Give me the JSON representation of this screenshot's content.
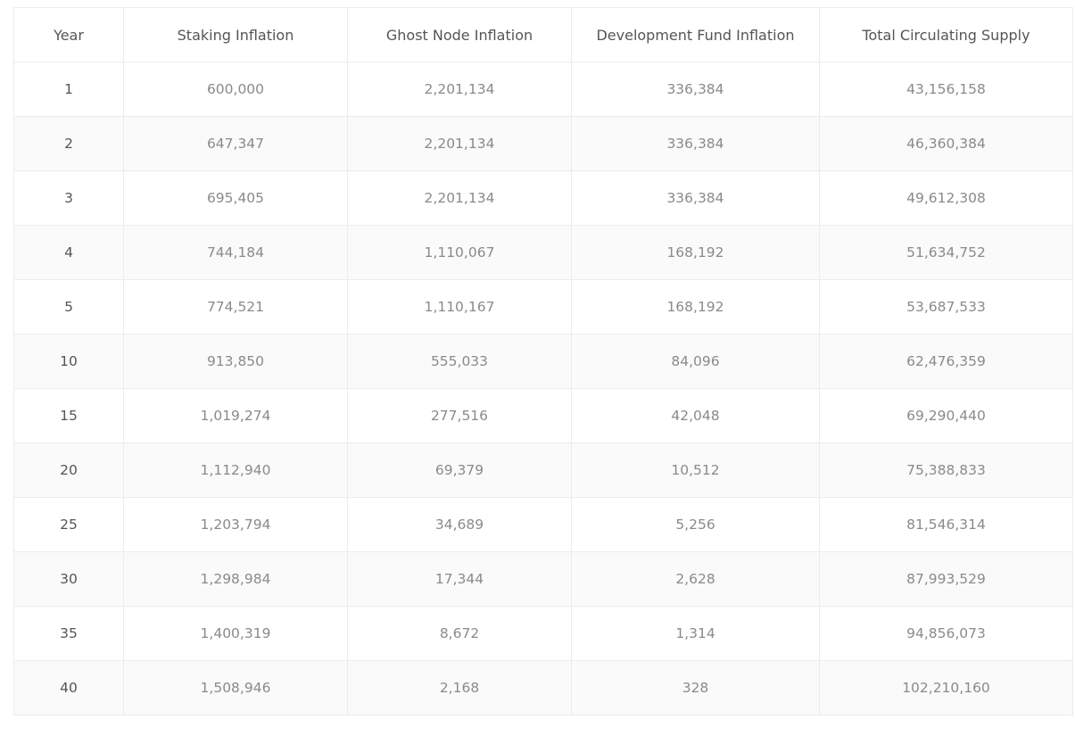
{
  "chart_data": {
    "type": "table",
    "columns": [
      "Year",
      "Staking Inflation",
      "Ghost Node Inflation",
      "Development Fund Inflation",
      "Total Circulating Supply"
    ],
    "rows": [
      [
        "1",
        "600,000",
        "2,201,134",
        "336,384",
        "43,156,158"
      ],
      [
        "2",
        "647,347",
        "2,201,134",
        "336,384",
        "46,360,384"
      ],
      [
        "3",
        "695,405",
        "2,201,134",
        "336,384",
        "49,612,308"
      ],
      [
        "4",
        "744,184",
        "1,110,067",
        "168,192",
        "51,634,752"
      ],
      [
        "5",
        "774,521",
        "1,110,167",
        "168,192",
        "53,687,533"
      ],
      [
        "10",
        "913,850",
        "555,033",
        "84,096",
        "62,476,359"
      ],
      [
        "15",
        "1,019,274",
        "277,516",
        "42,048",
        "69,290,440"
      ],
      [
        "20",
        "1,112,940",
        "69,379",
        "10,512",
        "75,388,833"
      ],
      [
        "25",
        "1,203,794",
        "34,689",
        "5,256",
        "81,546,314"
      ],
      [
        "30",
        "1,298,984",
        "17,344",
        "2,628",
        "87,993,529"
      ],
      [
        "35",
        "1,400,319",
        "8,672",
        "1,314",
        "94,856,073"
      ],
      [
        "40",
        "1,508,946",
        "2,168",
        "328",
        "102,210,160"
      ]
    ]
  }
}
